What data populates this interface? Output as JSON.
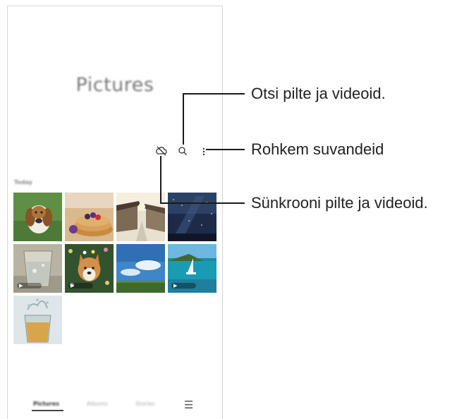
{
  "screen": {
    "title": "Pictures",
    "section_label": "Today",
    "icons": {
      "sync": "cloud-off-icon",
      "search": "search-icon",
      "more": "more-vertical-icon"
    },
    "thumbnails": [
      {
        "name": "beagle-dog",
        "video": false
      },
      {
        "name": "pancakes-berries",
        "video": false
      },
      {
        "name": "village-street",
        "video": false
      },
      {
        "name": "starry-night-sky",
        "video": false
      },
      {
        "name": "water-glass",
        "video": true
      },
      {
        "name": "corgi-dog-flowers",
        "video": true
      },
      {
        "name": "blue-sky-field",
        "video": false
      },
      {
        "name": "sailboat-bay",
        "video": true
      },
      {
        "name": "splash-glass",
        "video": false
      }
    ],
    "bottom_nav": {
      "tabs": [
        "Pictures",
        "Albums",
        "Stories"
      ],
      "active": "Pictures",
      "menu_icon": "menu-icon"
    }
  },
  "callouts": {
    "search": "Otsi pilte ja videoid.",
    "more": "Rohkem suvandeid",
    "sync": "Sünkrooni pilte ja videoid."
  }
}
